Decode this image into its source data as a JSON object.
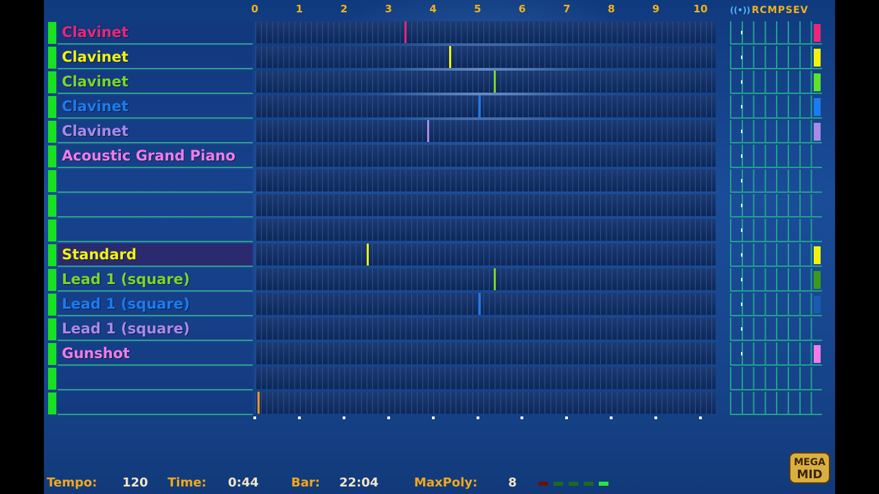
{
  "timeline": {
    "ruler_labels": [
      "0",
      "1",
      "2",
      "3",
      "4",
      "5",
      "6",
      "7",
      "8",
      "9",
      "10"
    ]
  },
  "tracks": [
    {
      "name": "Clavinet",
      "color": "#e8277a",
      "meter": "#e8277a",
      "note_at": 3.35,
      "selected": false
    },
    {
      "name": "Clavinet",
      "color": "#f2f20f",
      "meter": "#f2f20f",
      "note_at": 4.35,
      "selected": false
    },
    {
      "name": "Clavinet",
      "color": "#7ad62a",
      "meter": "#5ce22a",
      "note_at": 5.35,
      "selected": false
    },
    {
      "name": "Clavinet",
      "color": "#1c7cee",
      "meter": "#1c7cee",
      "note_at": 5.0,
      "selected": false
    },
    {
      "name": "Clavinet",
      "color": "#a98ae8",
      "meter": "#a98ae8",
      "note_at": 3.85,
      "selected": false
    },
    {
      "name": "Acoustic Grand Piano",
      "color": "#f07ce8",
      "meter": "",
      "note_at": null,
      "selected": false
    },
    {
      "name": "",
      "color": "",
      "meter": "",
      "note_at": null,
      "selected": false
    },
    {
      "name": "",
      "color": "",
      "meter": "",
      "note_at": null,
      "selected": false
    },
    {
      "name": "",
      "color": "",
      "meter": "",
      "note_at": null,
      "selected": false
    },
    {
      "name": "Standard",
      "color": "#f2f20f",
      "meter": "#f2f20f",
      "note_at": 2.5,
      "selected": true
    },
    {
      "name": "Lead 1 (square)",
      "color": "#7ad62a",
      "meter": "#3a9a20",
      "note_at": 5.35,
      "selected": false
    },
    {
      "name": "Lead 1 (square)",
      "color": "#1c7cee",
      "meter": "#1a5ab0",
      "note_at": 5.0,
      "selected": false
    },
    {
      "name": "Lead 1 (square)",
      "color": "#a98ae8",
      "meter": "",
      "note_at": null,
      "selected": false
    },
    {
      "name": "Gunshot",
      "color": "#f07ce8",
      "meter": "#f07ce8",
      "note_at": null,
      "selected": false
    },
    {
      "name": "",
      "color": "",
      "meter": "",
      "note_at": null,
      "selected": false
    },
    {
      "name": "",
      "color": "#f2962a",
      "meter": "",
      "note_at": 0.05,
      "selected": false
    }
  ],
  "mixer": {
    "icon": "radio-icon",
    "columns": "RCMPSEV"
  },
  "status": {
    "tempo_label": "Tempo:",
    "tempo_value": "120",
    "time_label": "Time:",
    "time_value": "0:44",
    "bar_label": "Bar:",
    "bar_value": "22:04",
    "maxpoly_label": "MaxPoly:",
    "maxpoly_value": "8",
    "polyphony_leds": [
      "#6a1010",
      "#1a6a20",
      "#1a6a20",
      "#1a6a20",
      "#27e63a"
    ]
  },
  "logo": {
    "text_top": "MEGA",
    "text_bottom": "MID"
  }
}
